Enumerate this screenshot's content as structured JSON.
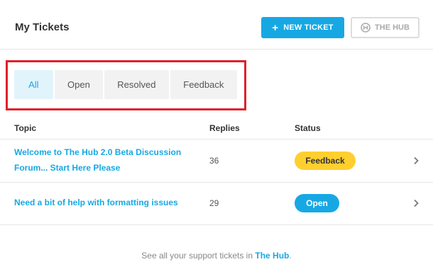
{
  "header": {
    "title": "My Tickets",
    "new_ticket_plus": "+",
    "new_ticket_label": "NEW TICKET",
    "hub_label": "THE HUB",
    "hub_icon": "hub-logo-icon"
  },
  "tabs": [
    {
      "label": "All",
      "active": true
    },
    {
      "label": "Open",
      "active": false
    },
    {
      "label": "Resolved",
      "active": false
    },
    {
      "label": "Feedback",
      "active": false
    }
  ],
  "table": {
    "columns": [
      "Topic",
      "Replies",
      "Status"
    ],
    "rows": [
      {
        "topic_line1": "Welcome to The Hub 2.0 Beta Discussion",
        "topic_line2": "Forum... Start Here Please",
        "replies": "36",
        "status": "Feedback",
        "chevron_icon": "chevron-right-icon"
      },
      {
        "topic_line1": "Need a bit of help with formatting issues",
        "replies": "29",
        "status": "Open",
        "chevron_icon": "chevron-right-icon"
      }
    ]
  },
  "footer": {
    "text": "See all your support tickets in ",
    "link": "The Hub",
    "end": "."
  },
  "colors": {
    "accent": "#17a8e3",
    "feedback_badge": "#fecf2f",
    "highlight_border": "#e0202a",
    "active_tab_bg": "#e1f4fc"
  }
}
